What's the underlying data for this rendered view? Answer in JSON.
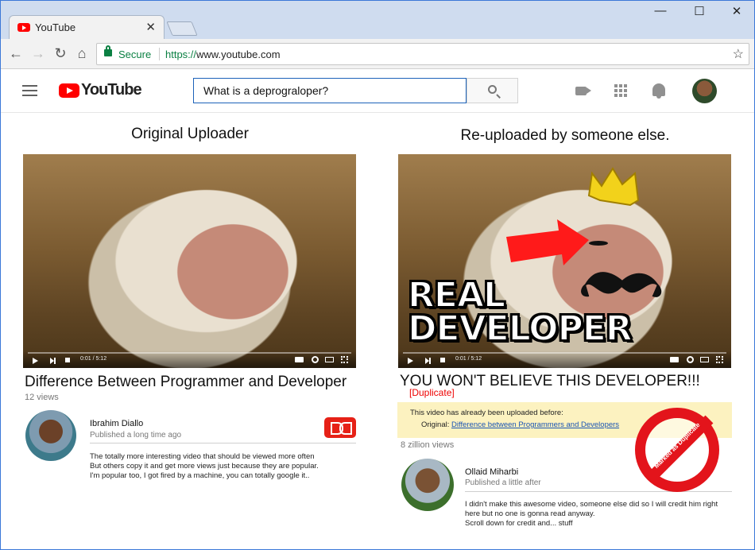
{
  "browser": {
    "tab_title": "YouTube",
    "tab_close": "✕",
    "window_controls": [
      "—",
      "☐",
      "✕"
    ],
    "secure_label": "Secure",
    "url_scheme": "https://",
    "url_host": "www.youtube.com"
  },
  "youtube": {
    "logo_text": "YouTube",
    "search_value": "What is a deprograloper?"
  },
  "left": {
    "heading": "Original Uploader",
    "video_time": "0:01 / 5:12",
    "title": "Difference Between Programmer and Developer",
    "views": "12 views",
    "channel": "Ibrahim Diallo",
    "published": "Published a long time ago",
    "description": [
      "The totally more interesting video that should be viewed more often",
      "But others copy it and get more views just because they are popular.",
      "I'm popular too, I got fired by a machine, you can totally google it.."
    ]
  },
  "right": {
    "heading": "Re-uploaded by someone else.",
    "video_time": "0:01 / 5:12",
    "overlay_line1": "REAL",
    "overlay_line2": "DEVELOPER",
    "title": "YOU WON'T BELIEVE THIS DEVELOPER!!!",
    "duplicate_tag": "[Duplicate]",
    "notice_line1": "This video has already been uploaded before:",
    "notice_original_label": "Original:",
    "notice_original_link": "Difference between Programmers and Developers",
    "stamp_text": "Marked as Duplicate",
    "views": "8 zillion views",
    "channel": "Ollaid Miharbi",
    "published": "Published a little after",
    "description": [
      "I didn't make this awesome video, someone else did so I will credit him right",
      "here but no one is gonna read anyway.",
      "Scroll down for credit and... stuff"
    ]
  },
  "colors": {
    "youtube_red": "#ff0000",
    "search_border": "#1c62b9",
    "notice_bg": "#fcf2c0",
    "stamp_red": "#e3141b",
    "duplicate_red": "#e00000"
  }
}
